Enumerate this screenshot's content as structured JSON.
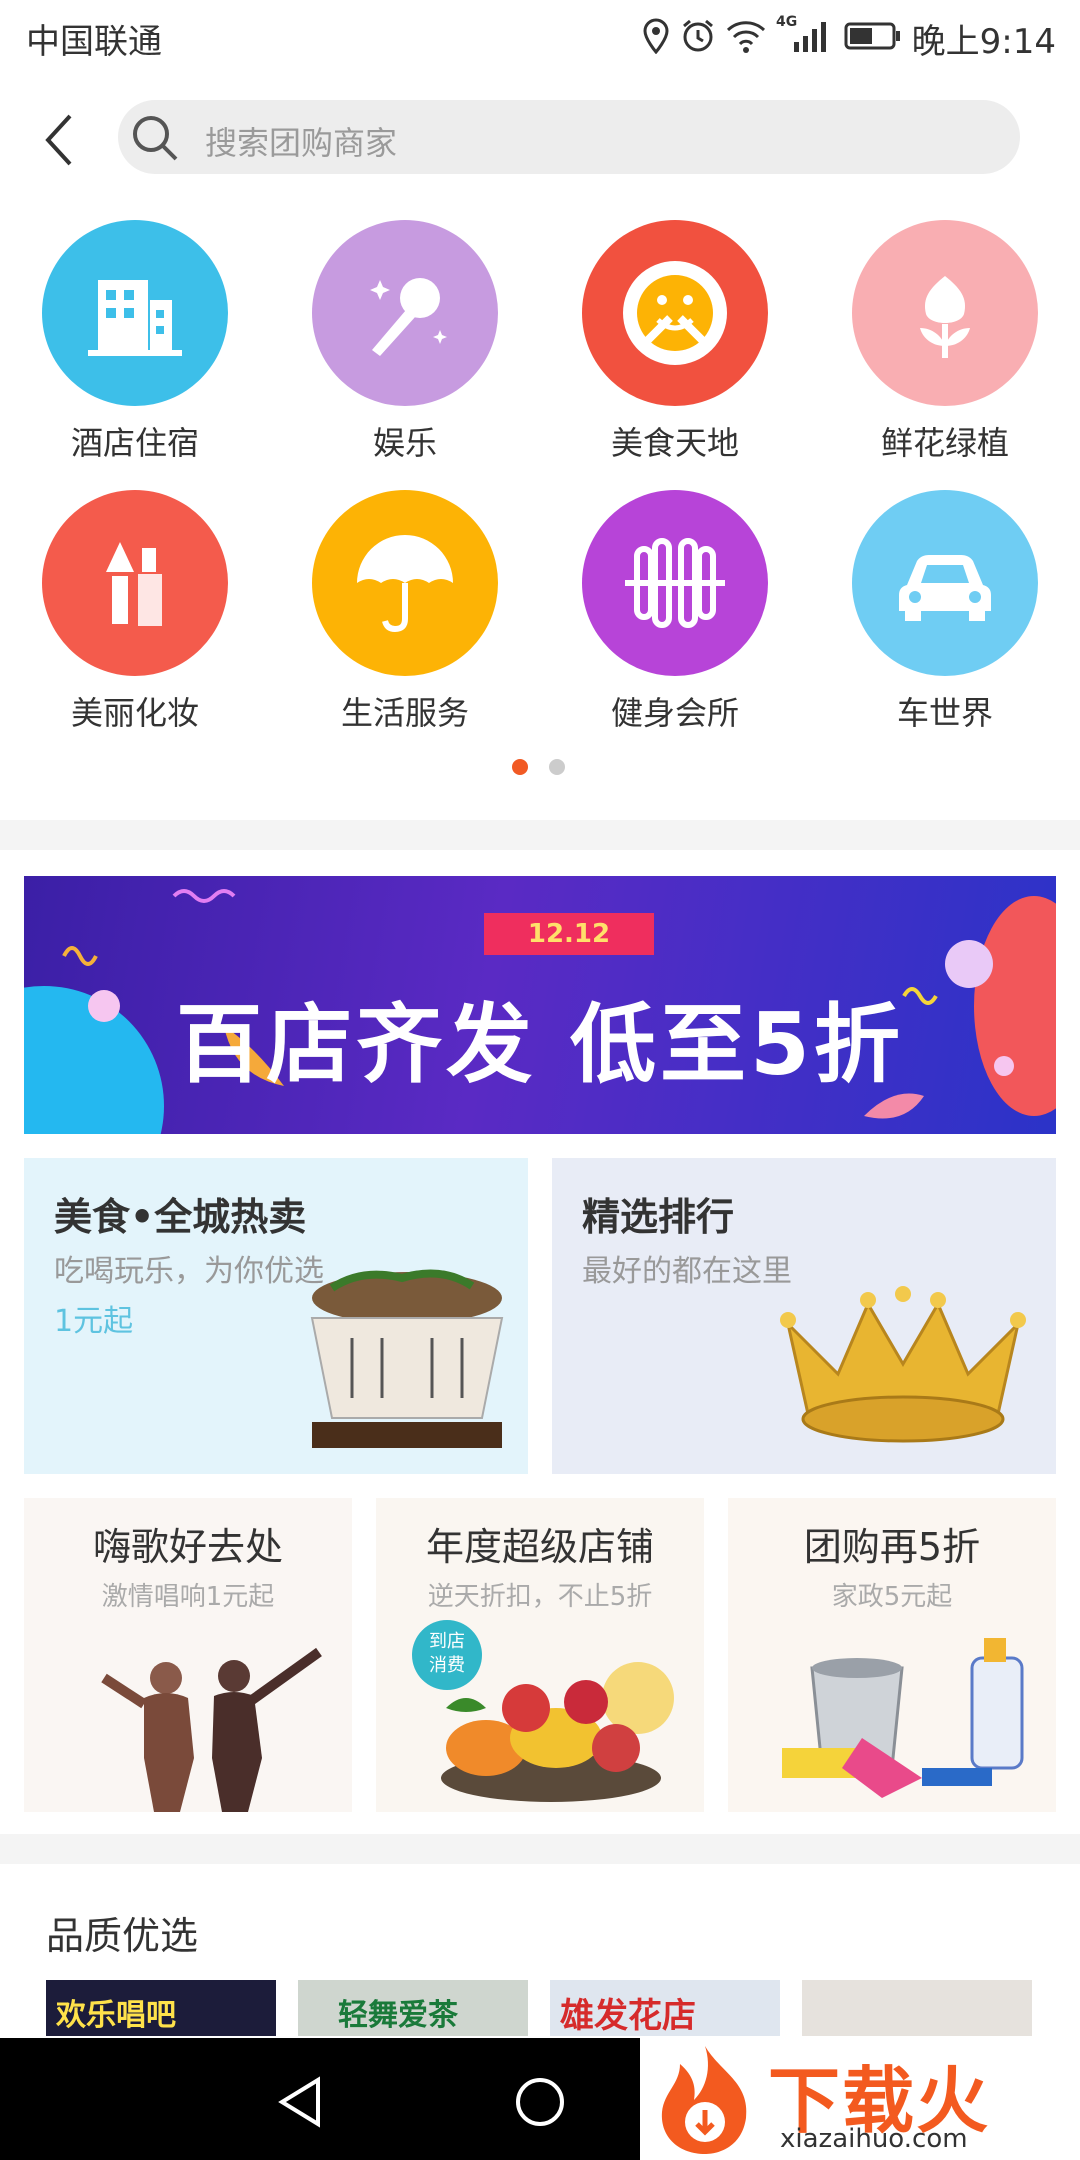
{
  "status_bar": {
    "carrier": "中国联通",
    "network": "4G",
    "time": "晚上9:14"
  },
  "search": {
    "placeholder": "搜索团购商家"
  },
  "categories": [
    {
      "label": "酒店住宿",
      "icon": "hotel-building-icon",
      "color": "#3dbfe9"
    },
    {
      "label": "娱乐",
      "icon": "microphone-icon",
      "color": "#c79be0"
    },
    {
      "label": "美食天地",
      "icon": "food-plate-icon",
      "color": "#f1513f"
    },
    {
      "label": "鲜花绿植",
      "icon": "flower-icon",
      "color": "#f9aeb2"
    },
    {
      "label": "美丽化妆",
      "icon": "makeup-icon",
      "color": "#f45b4c"
    },
    {
      "label": "生活服务",
      "icon": "umbrella-icon",
      "color": "#fdb305"
    },
    {
      "label": "健身会所",
      "icon": "fitness-icon",
      "color": "#b744d8"
    },
    {
      "label": "车世界",
      "icon": "car-icon",
      "color": "#6fcdf3"
    }
  ],
  "pager": {
    "active_color": "#f15a24",
    "inactive_color": "#cccccc"
  },
  "banner": {
    "date": "12.12",
    "title": "百店齐发 低至5折"
  },
  "promo_large": [
    {
      "title": "美食•全城热卖",
      "subtitle": "吃喝玩乐，为你优选",
      "price": "1元起",
      "bg": "#e3f4fb"
    },
    {
      "title": "精选排行",
      "subtitle": "最好的都在这里",
      "bg": "#e8ecf6"
    }
  ],
  "promo_small": [
    {
      "title": "嗨歌好去处",
      "subtitle": "激情唱响1元起"
    },
    {
      "title": "年度超级店铺",
      "subtitle": "逆天折扣，不止5折",
      "badge": "到店\n消费"
    },
    {
      "title": "团购再5折",
      "subtitle": "家政5元起"
    }
  ],
  "quality": {
    "title": "品质优选",
    "thumbs": [
      {
        "caption": "欢乐唱吧",
        "bg": "#1c1c3a",
        "fg": "#ffe24a"
      },
      {
        "caption": "轻舞爱茶",
        "bg": "#cfd6cf",
        "fg": "#1a7a3a"
      },
      {
        "caption": "雄发花店",
        "bg": "#dfe6ef",
        "fg": "#d62b2b"
      },
      {
        "caption": "",
        "bg": "#e6e2dd",
        "fg": "#777777"
      }
    ]
  },
  "watermark": {
    "brand": "下载火",
    "url": "xiazaihuo.com"
  }
}
